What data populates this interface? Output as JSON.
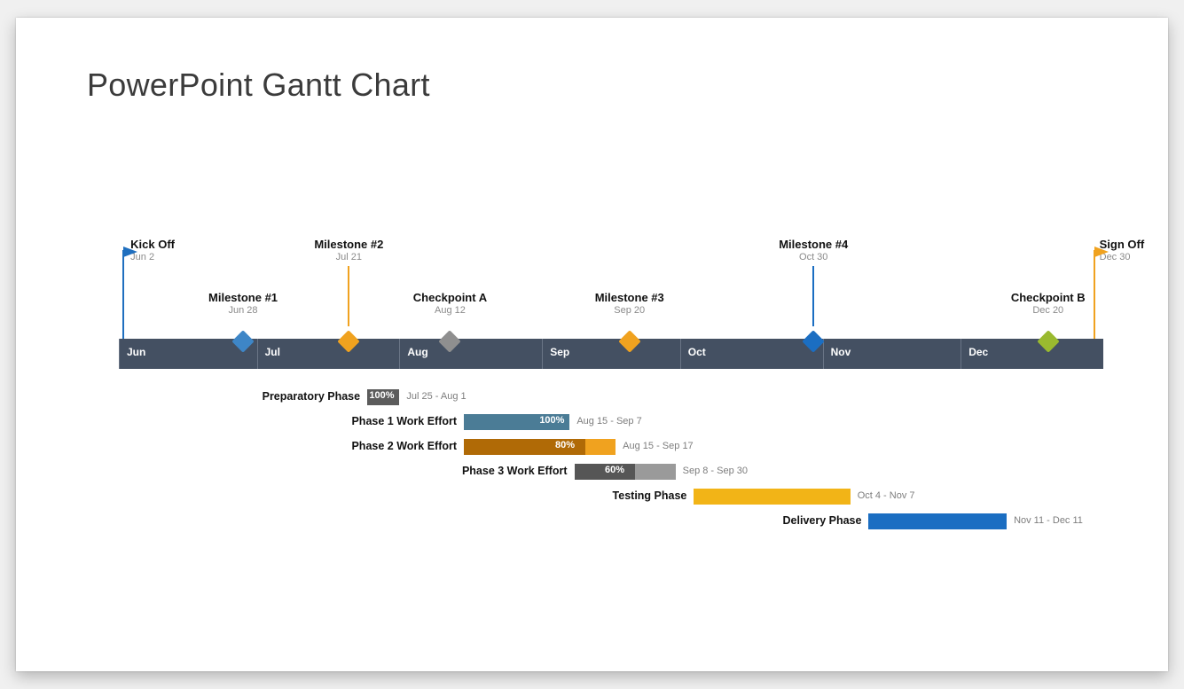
{
  "title": "PowerPoint Gantt Chart",
  "chart_data": {
    "type": "bar",
    "title": "PowerPoint Gantt Chart",
    "xlabel": "",
    "ylabel": "",
    "months": [
      "Jun",
      "Jul",
      "Aug",
      "Sep",
      "Oct",
      "Nov",
      "Dec"
    ],
    "milestones": [
      {
        "label": "Kick Off",
        "date": "Jun 2",
        "kind": "flag",
        "color": "#1f6fbf",
        "tall": true
      },
      {
        "label": "Milestone #1",
        "date": "Jun 28",
        "kind": "diamond",
        "color": "#3e86c7",
        "tall": false
      },
      {
        "label": "Milestone #2",
        "date": "Jul 21",
        "kind": "diamond",
        "color": "#f0a21f",
        "tall": true
      },
      {
        "label": "Checkpoint A",
        "date": "Aug 12",
        "kind": "diamond",
        "color": "#8f8f8f",
        "tall": false
      },
      {
        "label": "Milestone #3",
        "date": "Sep 20",
        "kind": "diamond",
        "color": "#f0a21f",
        "tall": false
      },
      {
        "label": "Milestone #4",
        "date": "Oct 30",
        "kind": "diamond",
        "color": "#1b6ec2",
        "tall": true
      },
      {
        "label": "Checkpoint B",
        "date": "Dec 20",
        "kind": "diamond",
        "color": "#9aba2f",
        "tall": false
      },
      {
        "label": "Sign Off",
        "date": "Dec 30",
        "kind": "flag",
        "color": "#f0a21f",
        "tall": true
      }
    ],
    "tasks": [
      {
        "name": "Preparatory Phase",
        "start": "Jul 25",
        "end": "Aug 1",
        "range": "Jul 25 - Aug 1",
        "pct": 100,
        "done_color": "#5c5c5c",
        "rest_color": "#5c5c5c"
      },
      {
        "name": "Phase 1 Work Effort",
        "start": "Aug 15",
        "end": "Sep 7",
        "range": "Aug 15 - Sep 7",
        "pct": 100,
        "done_color": "#4b7c96",
        "rest_color": "#4b7c96"
      },
      {
        "name": "Phase 2 Work Effort",
        "start": "Aug 15",
        "end": "Sep 17",
        "range": "Aug 15 - Sep 17",
        "pct": 80,
        "done_color": "#b06a06",
        "rest_color": "#f0a21f"
      },
      {
        "name": "Phase 3 Work Effort",
        "start": "Sep 8",
        "end": "Sep 30",
        "range": "Sep 8 - Sep 30",
        "pct": 60,
        "done_color": "#565656",
        "rest_color": "#9a9a9a"
      },
      {
        "name": "Testing Phase",
        "start": "Oct 4",
        "end": "Nov 7",
        "range": "Oct 4 - Nov 7",
        "pct": 0,
        "done_color": "#f2b417",
        "rest_color": "#f2b417"
      },
      {
        "name": "Delivery Phase",
        "start": "Nov 11",
        "end": "Dec 11",
        "range": "Nov 11 - Dec 11",
        "pct": 0,
        "done_color": "#1b6ec2",
        "rest_color": "#1b6ec2"
      }
    ]
  }
}
